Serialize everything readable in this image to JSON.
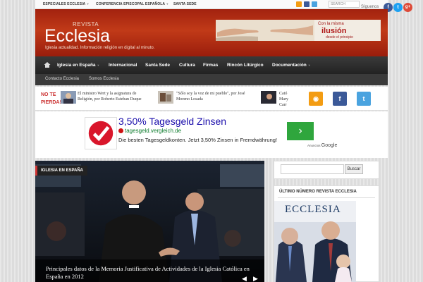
{
  "topbar": {
    "links": [
      "ESPECIALES ECCLESIA",
      "CONFERENCIA EPISCOPAL ESPAÑOLA",
      "SANTA SEDE"
    ],
    "search_placeholder": "SEARCH",
    "follow_label": "Síguenos",
    "social": [
      {
        "name": "facebook",
        "glyph": "f",
        "color": "#3b5998"
      },
      {
        "name": "twitter",
        "glyph": "t",
        "color": "#1da1f2"
      },
      {
        "name": "google-plus",
        "glyph": "g+",
        "color": "#dd4b39"
      }
    ]
  },
  "header": {
    "logo_small": "REVISTA",
    "logo_main": "Ecclesia",
    "tagline": "Iglesia actualidad. Información religión en digital al minuto.",
    "banner": {
      "line1": "Con la misma",
      "line2": "ilusión",
      "line3": "desde el principio"
    }
  },
  "nav": {
    "items": [
      "Iglesia en España",
      "Internacional",
      "Santa Sede",
      "Cultura",
      "Firmas",
      "Rincón Litúrgico",
      "Documentación"
    ],
    "subitems": [
      "Contacto Ecclesia",
      "Somos Ecclesia"
    ]
  },
  "no_te_pierdas": {
    "label_line1": "NO TE",
    "label_line2": "PIERDAS",
    "items": [
      "El ministro Wert y la asignatura de Religión, por Roberto Esteban Duque",
      "\"Sólo soy la voz de mi pueblo\", por José Moreno Losada",
      "Cató Mary Carr"
    ]
  },
  "ad": {
    "title": "3,50% Tagesgeld Zinsen",
    "url": "tagesgeld.vergleich.de",
    "description": "Die besten Tagesgeldkonten. Jetzt 3,50% Zinsen in Fremdwährung!",
    "arrow": "›",
    "by_label": "Anuncios",
    "by_brand": "Google"
  },
  "featured": {
    "category": "IGLESIA EN ESPAÑA",
    "caption": "Principales datos de la Memoria Justificativa de Actividades de la Iglesia Católica en España en 2012",
    "prev": "◀",
    "next": "▶"
  },
  "sidebar": {
    "search_button": "Buscar",
    "widget_title": "ÚLTIMO NÚMERO REVISTA ECCLESIA",
    "cover_title": "ECCLESIA"
  }
}
